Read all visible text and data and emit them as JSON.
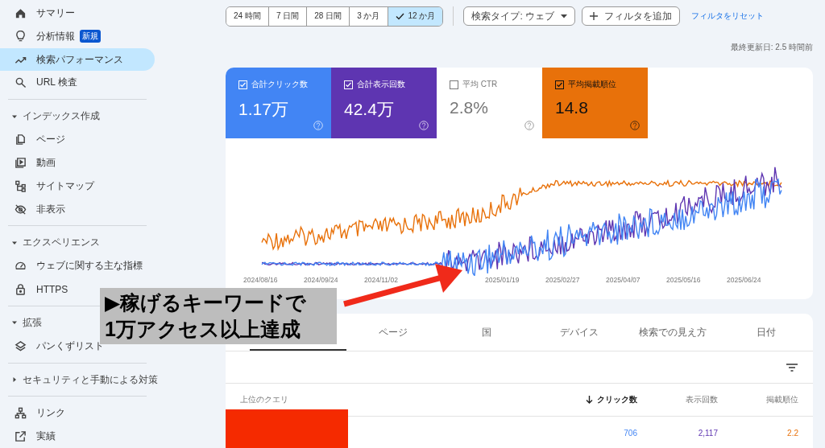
{
  "sidebar": {
    "groups": [
      {
        "items": [
          {
            "label": "サマリー",
            "selected": false
          },
          {
            "label": "分析情報",
            "badge": "新規",
            "selected": false
          },
          {
            "label": "検索パフォーマンス",
            "selected": true
          },
          {
            "label": "URL 検査",
            "selected": false
          }
        ]
      },
      {
        "header": "インデックス作成",
        "expanded": true,
        "items": [
          {
            "label": "ページ",
            "selected": false
          },
          {
            "label": "動画",
            "selected": false
          },
          {
            "label": "サイトマップ",
            "selected": false
          },
          {
            "label": "非表示",
            "selected": false
          }
        ]
      },
      {
        "header": "エクスペリエンス",
        "expanded": true,
        "items": [
          {
            "label": "ウェブに関する主な指標",
            "selected": false
          },
          {
            "label": "HTTPS",
            "selected": false
          }
        ]
      },
      {
        "header": "拡張",
        "expanded": true,
        "items": [
          {
            "label": "パンくずリスト",
            "selected": false
          }
        ]
      },
      {
        "header": "セキュリティと手動による対策",
        "expanded": false
      },
      {
        "items": [
          {
            "label": "リンク",
            "selected": false
          },
          {
            "label": "実績",
            "selected": false
          }
        ]
      }
    ]
  },
  "date_ranges": [
    {
      "label": "24 時間",
      "selected": false
    },
    {
      "label": "7 日間",
      "selected": false
    },
    {
      "label": "28 日間",
      "selected": false
    },
    {
      "label": "3 か月",
      "selected": false
    },
    {
      "label": "12 か月",
      "selected": true
    }
  ],
  "search_type": "検索タイプ: ウェブ",
  "add_filter": "フィルタを追加",
  "reset_filter": "フィルタをリセット",
  "last_updated": "最終更新日: 2.5 時間前",
  "metrics": [
    {
      "label": "合計クリック数",
      "value": "1.17万",
      "checked": true,
      "color": "#4285f4"
    },
    {
      "label": "合計表示回数",
      "value": "42.4万",
      "checked": true,
      "color": "#5e35b1"
    },
    {
      "label": "平均 CTR",
      "value": "2.8%",
      "checked": false
    },
    {
      "label": "平均掲載順位",
      "value": "14.8",
      "checked": true,
      "color": "#e8710a"
    }
  ],
  "chart_x_labels": [
    "2024/08/16",
    "2024/09/24",
    "2024/11/02",
    "2025/01/19",
    "2025/02/27",
    "2025/04/07",
    "2025/05/16",
    "2025/06/24"
  ],
  "annotation": {
    "lines": [
      "▶稼げるキーワードで",
      "1万アクセス以上達成"
    ]
  },
  "table_tabs": [
    {
      "label": "ページ"
    },
    {
      "label": "国"
    },
    {
      "label": "デバイス"
    },
    {
      "label": "検索での見え方"
    },
    {
      "label": "日付"
    }
  ],
  "table": {
    "columns": [
      {
        "label": "上位のクエリ",
        "sorted": false
      },
      {
        "label": "クリック数",
        "sorted": true
      },
      {
        "label": "表示回数",
        "sorted": false
      },
      {
        "label": "掲載順位",
        "sorted": false
      }
    ],
    "rows": [
      {
        "cells": [
          {
            "kind": "redacted"
          },
          {
            "kind": "text",
            "text": "706"
          },
          {
            "kind": "text",
            "text": "2,117"
          },
          {
            "kind": "text",
            "text": "2.2"
          }
        ]
      }
    ]
  }
}
